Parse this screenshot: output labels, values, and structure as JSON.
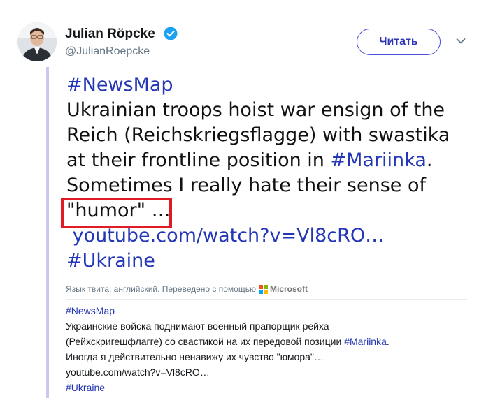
{
  "author": {
    "name": "Julian Röpcke",
    "handle": "@JulianRoepcke",
    "verified": true,
    "avatar_icon": "person-avatar-icon"
  },
  "follow_button": {
    "label": "Читать"
  },
  "menu": {
    "icon": "chevron-down-icon"
  },
  "tweet": {
    "hashtag_newsmap": "#NewsMap",
    "line1": "Ukrainian troops hoist war ensign of the",
    "line2": "Reich (Reichskriegsflagge) with swastika",
    "line3_text": "at their frontline position in ",
    "hashtag_mariinka": "#Mariinka",
    "line3_end": ".",
    "line4": "Sometimes I really hate their sense of",
    "line5": "\"humor\" …",
    "link": "youtube.com/watch?v=Vl8cRO…",
    "hashtag_ukraine": "#Ukraine"
  },
  "translation_note": {
    "text": "Язык твита: английский. Переведено с помощью",
    "provider": "Microsoft"
  },
  "translation": {
    "hashtag_newsmap": "#NewsMap",
    "line1": "Украинские войска поднимают военный прапорщик рейха",
    "line2_text": "(Рейхскригешфлагге) со свастикой на их передовой позиции ",
    "hashtag_mariinka": "#Mariinka",
    "line2_end": ".",
    "line3": "Иногда я действительно ненавижу их чувство \"юмора\"…",
    "link": "youtube.com/watch?v=Vl8cRO…",
    "hashtag_ukraine": "#Ukraine"
  },
  "colors": {
    "link": "#2336b5",
    "highlight_box": "#e01b24",
    "thread_line": "#c9c9ef",
    "verified_badge": "#1da1f2"
  }
}
